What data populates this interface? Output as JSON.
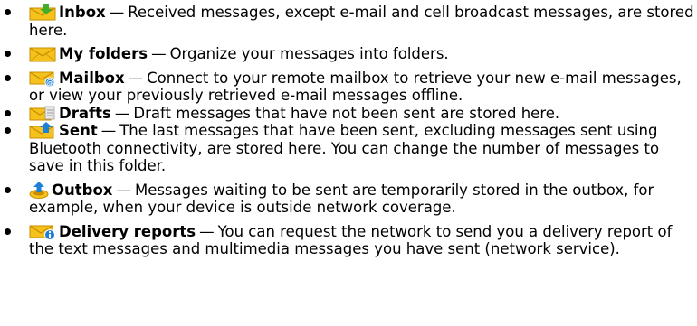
{
  "items": [
    {
      "icon": "inbox-folder-icon",
      "name": "Inbox",
      "desc": "Received messages, except e-mail and cell broadcast messages, are stored here."
    },
    {
      "icon": "my-folders-icon",
      "name": "My folders",
      "desc": "Organize your messages into folders."
    },
    {
      "icon": "mailbox-icon",
      "name": "Mailbox",
      "desc": "Connect to your remote mailbox to retrieve your new e-mail messages, or view your previously retrieved e-mail messages offline."
    },
    {
      "icon": "drafts-icon",
      "name": "Drafts",
      "desc": "Draft messages that have not been sent are stored here."
    },
    {
      "icon": "sent-icon",
      "name": "Sent",
      "desc": "The last messages that have been sent, excluding messages sent using Bluetooth connectivity, are stored here. You can change the number of messages to save in this folder."
    },
    {
      "icon": "outbox-icon",
      "name": "Outbox",
      "desc": "Messages waiting to be sent are temporarily stored in the outbox, for example, when your device is outside network coverage."
    },
    {
      "icon": "delivery-reports-icon",
      "name": "Delivery reports",
      "desc": "You can request the network to send you a delivery report of the text messages and multimedia messages you have sent (network service)."
    }
  ],
  "separator": "—",
  "colors": {
    "envelope": "#f4c21b",
    "envelope_edge": "#c98d00",
    "arrow_green": "#3fae2a",
    "arrow_blue": "#1d7fd6",
    "badge_blue": "#1f7fd8"
  }
}
